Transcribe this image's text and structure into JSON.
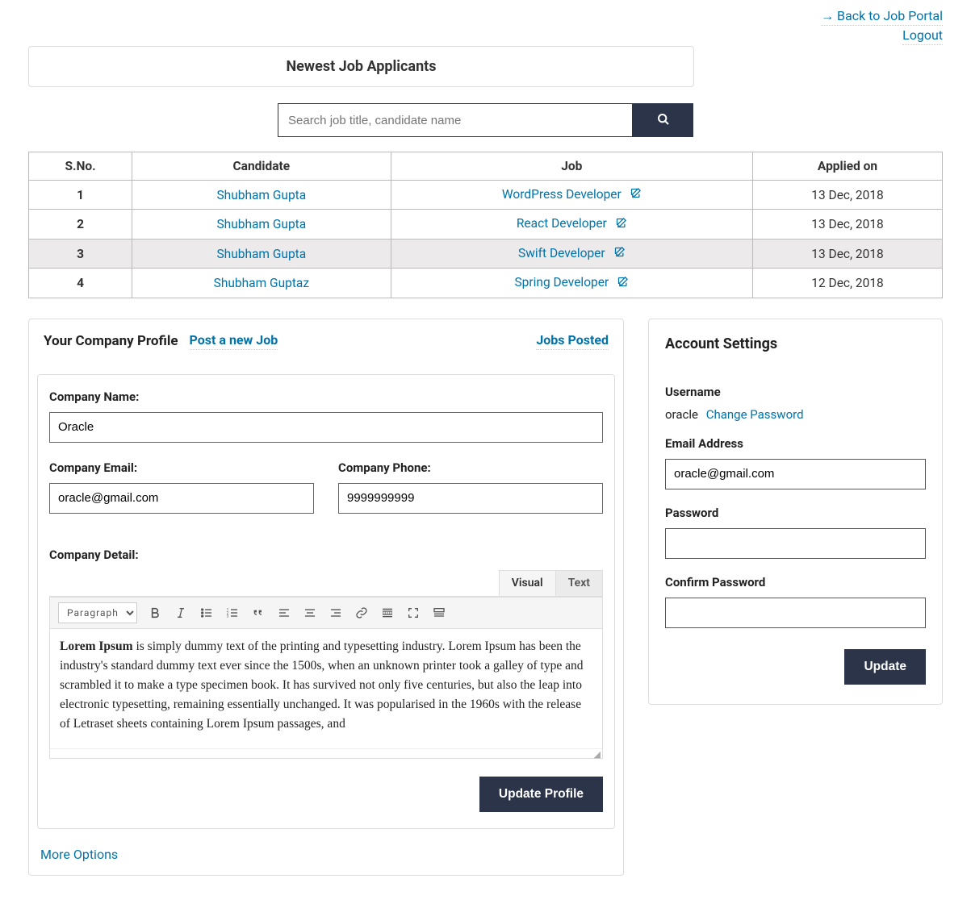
{
  "top_links": {
    "back": "→ Back to Job Portal",
    "logout": "Logout"
  },
  "applicants_panel": {
    "title": "Newest Job Applicants",
    "search_placeholder": "Search job title, candidate name",
    "columns": {
      "sno": "S.No.",
      "candidate": "Candidate",
      "job": "Job",
      "applied": "Applied on"
    },
    "rows": [
      {
        "sno": "1",
        "candidate": "Shubham Gupta",
        "job": "WordPress Developer",
        "applied": "13 Dec, 2018"
      },
      {
        "sno": "2",
        "candidate": "Shubham Gupta",
        "job": "React Developer",
        "applied": "13 Dec, 2018"
      },
      {
        "sno": "3",
        "candidate": "Shubham Gupta",
        "job": "Swift Developer",
        "applied": "13 Dec, 2018",
        "hover": true
      },
      {
        "sno": "4",
        "candidate": "Shubham Guptaz",
        "job": "Spring Developer",
        "applied": "12 Dec, 2018"
      }
    ]
  },
  "profile": {
    "header_title": "Your Company Profile",
    "post_job": "Post a new Job",
    "jobs_posted": "Jobs Posted",
    "labels": {
      "name": "Company Name:",
      "email": "Company Email:",
      "phone": "Company Phone:",
      "detail": "Company Detail:"
    },
    "values": {
      "name": "Oracle",
      "email": "oracle@gmail.com",
      "phone": "9999999999"
    },
    "editor": {
      "tabs": {
        "visual": "Visual",
        "text": "Text"
      },
      "paragraph_option": "Paragraph",
      "text_strong": "Lorem Ipsum",
      "text_rest": " is simply dummy text of the printing and typesetting industry. Lorem Ipsum has been the industry's standard dummy text ever since the 1500s, when an unknown printer took a galley of type and scrambled it to make a type specimen book. It has survived not only five centuries, but also the leap into electronic typesetting, remaining essentially unchanged. It was popularised in the 1960s with the release of Letraset sheets containing Lorem Ipsum passages, and"
    },
    "update_button": "Update Profile",
    "more_options": "More Options"
  },
  "account": {
    "title": "Account Settings",
    "labels": {
      "username": "Username",
      "email": "Email Address",
      "password": "Password",
      "confirm": "Confirm Password"
    },
    "username_value": "oracle",
    "change_password": "Change Password",
    "email_value": "oracle@gmail.com",
    "update_button": "Update"
  }
}
